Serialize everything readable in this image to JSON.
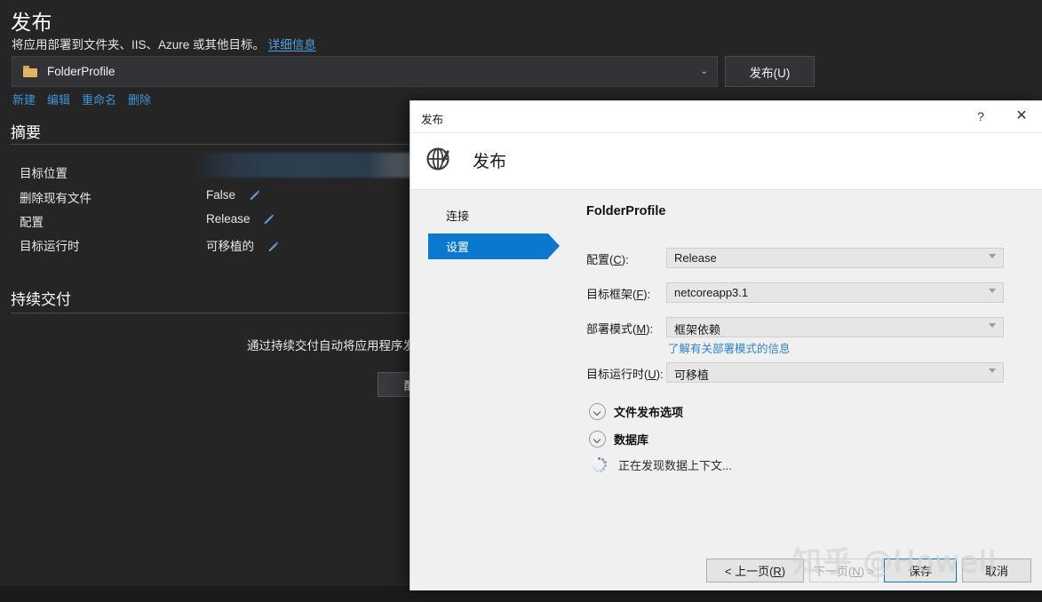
{
  "vs_page": {
    "title": "发布",
    "subtitle": "将应用部署到文件夹、IIS、Azure 或其他目标。",
    "subtitle_link": "详细信息",
    "profile": {
      "name": "FolderProfile",
      "icon": "folder-icon",
      "chevron": "⌄"
    },
    "publish_button": "发布(U)",
    "profile_links": [
      "新建",
      "编辑",
      "重命名",
      "删除"
    ],
    "summary": {
      "heading": "摘要",
      "rows": [
        {
          "label": "目标位置",
          "value": "",
          "redacted": true
        },
        {
          "label": "删除现有文件",
          "value": "False",
          "edit": "pencil-icon"
        },
        {
          "label": "配置",
          "value": "Release",
          "edit": "pencil-icon"
        },
        {
          "label": "目标运行时",
          "value": "可移植的",
          "edit": "pencil-icon"
        }
      ]
    },
    "continuous_delivery": {
      "heading": "持续交付",
      "description": "通过持续交付自动将应用程序发布到",
      "configure_button": "配置..."
    }
  },
  "dialog": {
    "titlebar": {
      "title": "发布",
      "help_icon": "?",
      "close_icon": "✕"
    },
    "banner": {
      "icon": "globe-publish-icon",
      "title": "发布"
    },
    "nav": [
      {
        "label": "连接",
        "selected": false
      },
      {
        "label": "设置",
        "selected": true
      }
    ],
    "form": {
      "heading": "FolderProfile",
      "fields": [
        {
          "label_pre": "配置(",
          "accel": "C",
          "label_post": "):",
          "value": "Release"
        },
        {
          "label_pre": "目标框架(",
          "accel": "F",
          "label_post": "):",
          "value": "netcoreapp3.1"
        },
        {
          "label_pre": "部署模式(",
          "accel": "M",
          "label_post": "):",
          "value": "框架依赖"
        },
        {
          "label_pre": "目标运行时(",
          "accel": "U",
          "label_post": "):",
          "value": "可移植"
        }
      ],
      "deploy_help_link": "了解有关部署模式的信息",
      "expanders": [
        {
          "label": "文件发布选项",
          "icon": "chevron-down-icon"
        },
        {
          "label": "数据库",
          "icon": "chevron-down-icon"
        }
      ],
      "status": {
        "icon": "loading-spinner-icon",
        "text": "正在发现数据上下文..."
      }
    },
    "footer": {
      "prev_pre": "< 上一页(",
      "prev_accel": "R",
      "prev_post": ")",
      "next_pre": "下一页(",
      "next_accel": "N",
      "next_post": ") >",
      "save": "保存",
      "cancel": "取消"
    }
  },
  "watermark": "知乎 @Howell",
  "colors": {
    "accent_blue": "#0b78d0",
    "link_blue": "#3f94d8",
    "dialog_bg": "#f0f0f0",
    "vs_bg": "#252526",
    "folder_icon": "#e3b461"
  }
}
